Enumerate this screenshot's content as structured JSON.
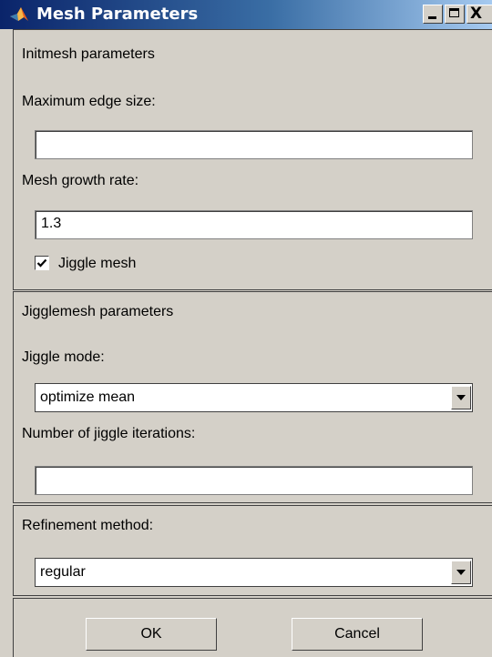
{
  "window": {
    "title": "Mesh Parameters",
    "minimize_glyph": "",
    "maximize_glyph": "",
    "close_glyph": "X"
  },
  "initmesh": {
    "section_label": "Initmesh parameters",
    "max_edge_label": "Maximum edge size:",
    "max_edge_value": "",
    "growth_label": "Mesh growth rate:",
    "growth_value": "1.3",
    "jiggle_label": "Jiggle mesh",
    "jiggle_checked": true
  },
  "jigglemesh": {
    "section_label": "Jigglemesh parameters",
    "mode_label": "Jiggle mode:",
    "mode_value": "optimize mean",
    "iterations_label": "Number of jiggle iterations:",
    "iterations_value": ""
  },
  "refinement": {
    "method_label": "Refinement method:",
    "method_value": "regular"
  },
  "buttons": {
    "ok_label": "OK",
    "cancel_label": "Cancel"
  },
  "colors": {
    "title_gradient_start": "#0a246a",
    "title_gradient_end": "#a6caf0",
    "face": "#d4d0c8"
  },
  "icons": {
    "app": "matlab-logo-icon",
    "checkbox_mark": "checkmark-icon",
    "dropdown": "dropdown-arrow-icon"
  }
}
